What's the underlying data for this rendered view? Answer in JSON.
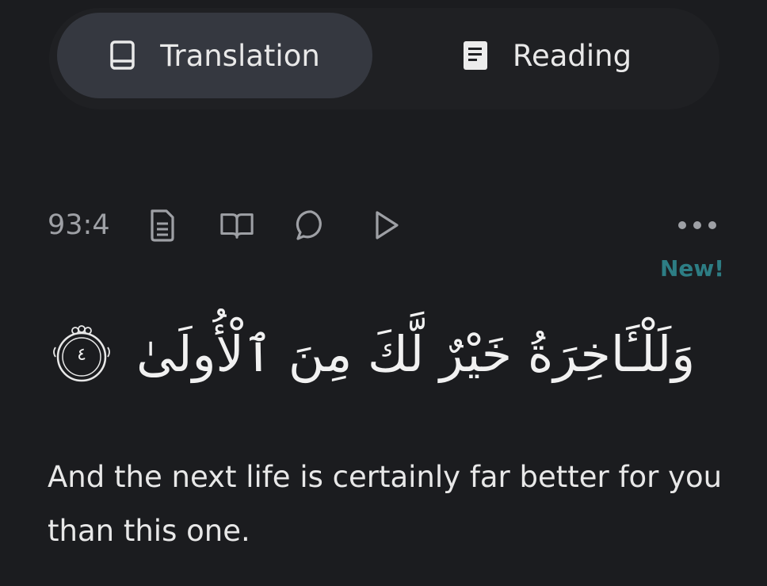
{
  "tabs": {
    "translation_label": "Translation",
    "translation_icon": "book-icon",
    "reading_label": "Reading",
    "reading_icon": "document-icon",
    "active": "translation"
  },
  "verse": {
    "key": "93:4",
    "actions": [
      "tafsir-icon",
      "book-open-icon",
      "comment-icon",
      "play-icon"
    ],
    "more_icon": "more-horizontal-icon",
    "new_badge": "New!",
    "arabic": "وَلَلْـَٔاخِرَةُ خَيْرٌ لَّكَ مِنَ ٱلْأُولَىٰ",
    "ayah_number": "٤",
    "translation": "And the next life is certainly far better for you than this one."
  },
  "colors": {
    "background": "#1b1c1f",
    "active_tab": "#353840",
    "accent_new": "#2d7d84",
    "muted_text": "#9ea0a5"
  }
}
